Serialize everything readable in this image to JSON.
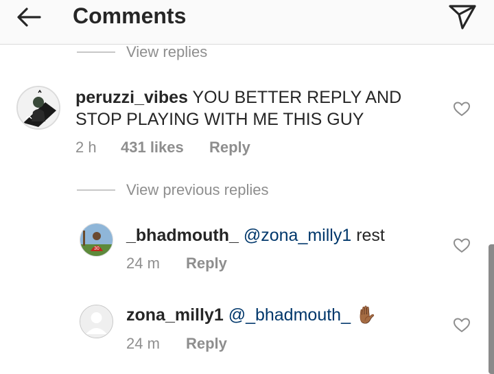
{
  "header": {
    "title": "Comments"
  },
  "thread1": {
    "view_replies": "View replies"
  },
  "comment_main": {
    "username": "peruzzi_vibes",
    "text": "YOU BETTER REPLY AND STOP PLAYING WITH ME THIS GUY",
    "time": "2 h",
    "likes": "431 likes",
    "reply_label": "Reply"
  },
  "thread2": {
    "view_previous": "View previous replies"
  },
  "replies": [
    {
      "username": "_bhadmouth_",
      "mention": "@zona_milly1",
      "text": "rest",
      "time": "24 m",
      "reply_label": "Reply"
    },
    {
      "username": "zona_milly1",
      "mention": "@_bhadmouth_",
      "emoji": "✋🏾",
      "time": "24 m",
      "reply_label": "Reply"
    }
  ]
}
